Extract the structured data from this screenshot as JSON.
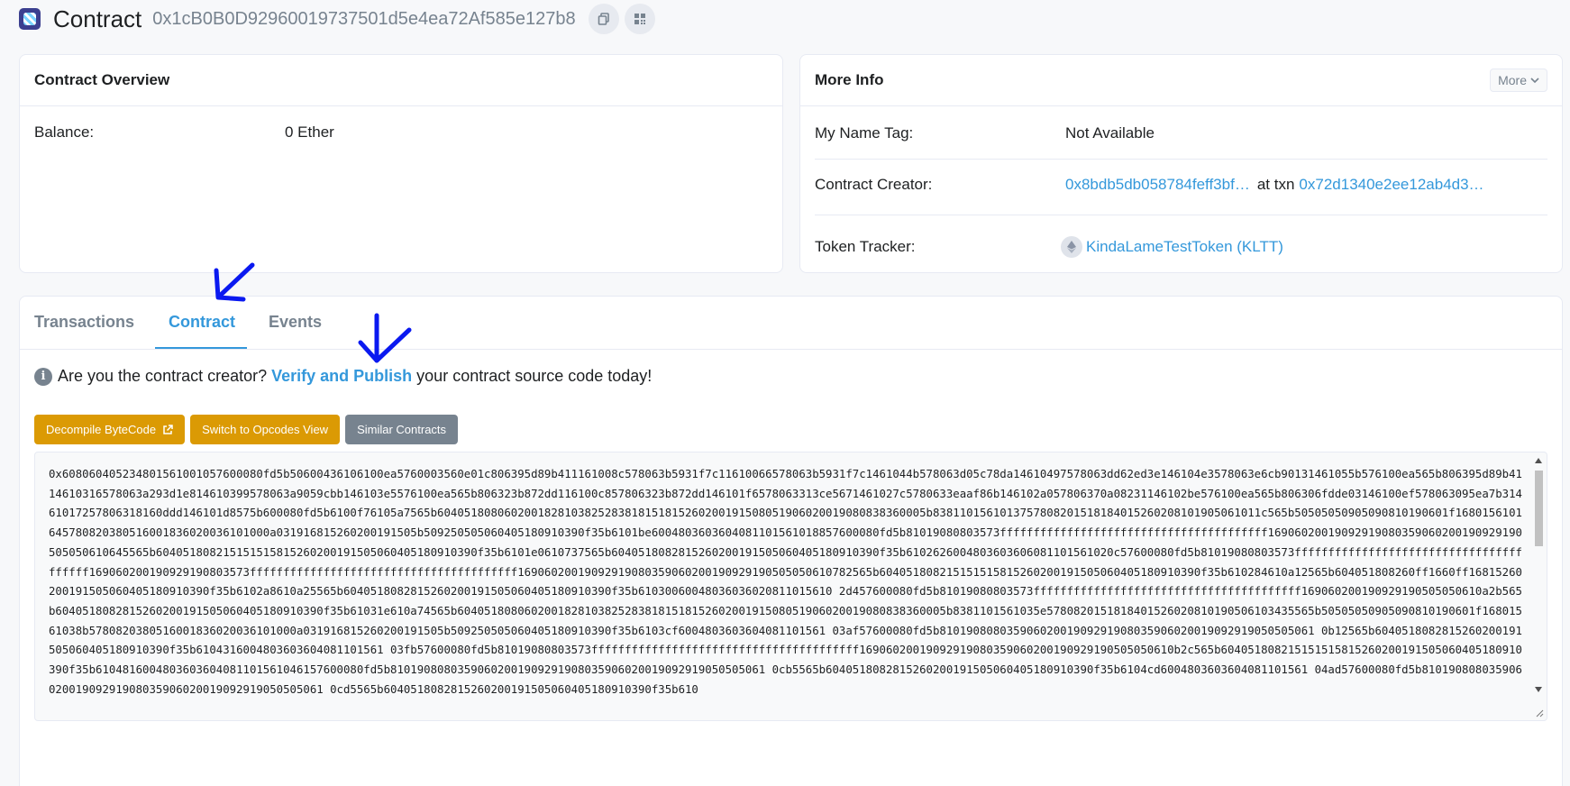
{
  "header": {
    "title": "Contract",
    "address": "0x1cB0B0D92960019737501d5e4ea72Af585e127b8"
  },
  "overview": {
    "title": "Contract Overview",
    "balance_label": "Balance:",
    "balance_value": "0 Ether"
  },
  "more_info": {
    "title": "More Info",
    "more_button": "More",
    "name_tag_label": "My Name Tag:",
    "name_tag_value": "Not Available",
    "creator_label": "Contract Creator:",
    "creator_address": "0x8bdb5db058784feff3bf…",
    "at_txn": "at txn",
    "creator_txn": "0x72d1340e2ee12ab4d3…",
    "token_label": "Token Tracker:",
    "token_value": "KindaLameTestToken (KLTT)"
  },
  "tabs": [
    {
      "label": "Transactions"
    },
    {
      "label": "Contract"
    },
    {
      "label": "Events"
    }
  ],
  "notice": {
    "prefix": "Are you the contract creator?",
    "link": "Verify and Publish",
    "suffix": "your contract source code today!"
  },
  "buttons": {
    "decompile": "Decompile ByteCode",
    "opcodes": "Switch to Opcodes View",
    "similar": "Similar Contracts"
  },
  "bytecode_lines": [
    "0x6080604052348015610010576000080fd5b50600436106100ea5760003560e01c806395d89b411161008c578063b5931f7c11610066578063b5931f7c1461044b578063d05c78da14610497578063dd62ed3e146104e3578063e6cb901314610",
    "55b576100ea565b806395d89b4114610316578063a293d1e814610399578063a9059cbb146103e5576100ea565b806323b872dd116100c857806323b872dd146101f6578063313ce5671461027c5780633eaaf86b146102a057806370a0823114",
    "6102be576100ea565b806306fdde03146100ef578063095ea7b3146101725780636318160ddd146101d8575b600080fd5b6100f76105a7565b604051808060200182810382528381815181526020019150805190602001908083836000",
    "5b838110156101375780820151818401526020810190506101111565b50505050905090810190601f1680156101645780820380516001836020036101000a0319168152602001915050925050506040518091039",
    "0f35b6101be6004803603604081101561018857600080fd5b81019080803573ffffffffffffffffffffffffffffffffffffffff16906020019092919080359060200190929190505050610645565b60405180821515151581526020019150",
    "50604051809103900f35b6101e0610737565b6040518082815260200191505060405180910390f35b6102626004803603606081101561020c57600080fd5b81019080803573ffffffffffffffffffffffffffffffffffffffff16906020019092919",
    "0803573ffffffffffffffffffffffffffffffffffffffff169060200190929190803590602001909291905050506107825",
    "65b604051808215151515815260200191505060405180910390f35b610284610a12565b604051808260ff1660ff16815260200191505060405180910390f35b6102a8610a25565b6040518082815260200191505060405180910390f35b6103006",
    "004803603602081101561 02d457600080fd5b81019080803573ffffffffffffffffffffffffffffffffffffffff16906020019092919050505061 0a2b565b604051808281526020019150506040518091039 0f35b61031e610a74565b604051808",
    "0602001828103825283818151815260200191508051906020019080838360005b838110156103 5e5780820151818401526020810190506103 43565b50505050905090810190601f16801561038b578082038051600183602003610100"
  ],
  "bytecode_full": "0x608060405234801561001057600080fd5b50600436106100ea5760003560e01c806395d89b411161008c578063b5931f7c11610066578063b5931f7c1461044b578063d05c78da14610497578063dd62ed3e146104e3578063e6cb90131461055b576100ea565b806395d89b4114610316578063a293d1e814610399578063a9059cbb146103e5576100ea565b806323b872dd116100c857806323b872dd146101f6578063313ce5671461027c5780633eaaf86b146102a057806370a08231146102be576100ea565b806306fdde03146100ef578063095ea7b31461017257806318160ddd146101d8575b600080fd5b6100f76105a7565b6040518080602001828103825283818151815260200191508051906020019080838360005b8381101561013757808201518184015260208101905061011c565b50505050905090810190601f1680156101645780820380516001836020036101000a031916815260200191505b509250505060405180910390f35b6101be6004803603604081101561018857600080fd5b81019080803573ffffffffffffffffffffffffffffffffffffffff16906020019092919080359060200190929190505050610645565b604051808215151515815260200191505060405180910390f35b6101e0610737565b6040518082815260200191505060405180910390f35b6102626004803603606081101561020c57600080fd5b81019080803573ffffffffffffffffffffffffffffffffffffffff169060200190929190803573ffffffffffffffffffffffffffffffffffffffff16906020019092919080359060200190929190505050610782565b604051808215151515815260200191505060405180910390f35b610284610a12565b604051808260ff1660ff16815260200191505060405180910390f35b6102a8610a25565b6040518082815260200191505060405180910390f35b61030060048036036020811015610 2d457600080fd5b81019080803573ffffffffffffffffffffffffffffffffffffffff169060200190929190505050610a2b565b6040518082815260200191505060405180910390f35b61031e610a74565b6040518080602001828103825283818151815260200191508051906020019080838360005b8381101561035e5780820151818401526020810190506103435565b50505050905090810190601f16801561038b5780820380516001836020036101000a031916815260200191505b509250505060405180910390f35b6103cf6004803603604081101561 03af57600080fd5b81019080803590602001909291908035906020019092919050505061 0b12565b6040518082815260200191505060405180910390f35b6104316004803603604081101561 03fb57600080fd5b81019080803573ffffffffffffffffffffffffffffffffffffffff16906020019092919080359060200190929190505050610b2c565b604051808215151515815260200191505060405180910390f35b6104816004803603604081101561046157600080fd5b81019080803590602001909291908035906020019092919050505061 0cb5565b6040518082815260200191505060405180910390f35b6104cd6004803603604081101561 04ad57600080fd5b81019080803590602001909291908035906020019092919050505061 0cd5565b6040518082815260200191505060405180910390f35b610"
}
